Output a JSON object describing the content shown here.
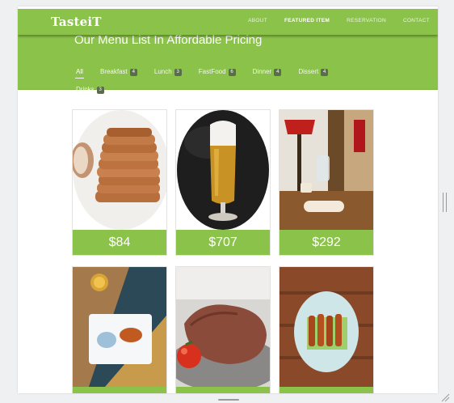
{
  "brand": "TasteiT",
  "nav": [
    {
      "label": "ABOUT",
      "active": false
    },
    {
      "label": "FEATURED ITEM",
      "active": true
    },
    {
      "label": "RESERVATION",
      "active": false
    },
    {
      "label": "CONTACT",
      "active": false
    }
  ],
  "hero": {
    "title": "Our Menu List In Affordable Pricing",
    "filters": [
      {
        "label": "All",
        "count": ""
      },
      {
        "label": "Breakfast",
        "count": "4"
      },
      {
        "label": "Lunch",
        "count": "3"
      },
      {
        "label": "FastFood",
        "count": "6"
      },
      {
        "label": "Dinner",
        "count": "4"
      },
      {
        "label": "Dissert",
        "count": "4"
      },
      {
        "label": "Drinks",
        "count": "3"
      }
    ]
  },
  "menu_items": [
    {
      "image": "bread-image",
      "price": "$84"
    },
    {
      "image": "beer-image",
      "price": "$707"
    },
    {
      "image": "restaurant-table-image",
      "price": "$292"
    },
    {
      "image": "grilled-dish-image",
      "price": ""
    },
    {
      "image": "steak-image",
      "price": ""
    },
    {
      "image": "kebab-plate-image",
      "price": ""
    }
  ],
  "colors": {
    "accent": "#8bc34a",
    "badge": "#5a6b4e"
  }
}
